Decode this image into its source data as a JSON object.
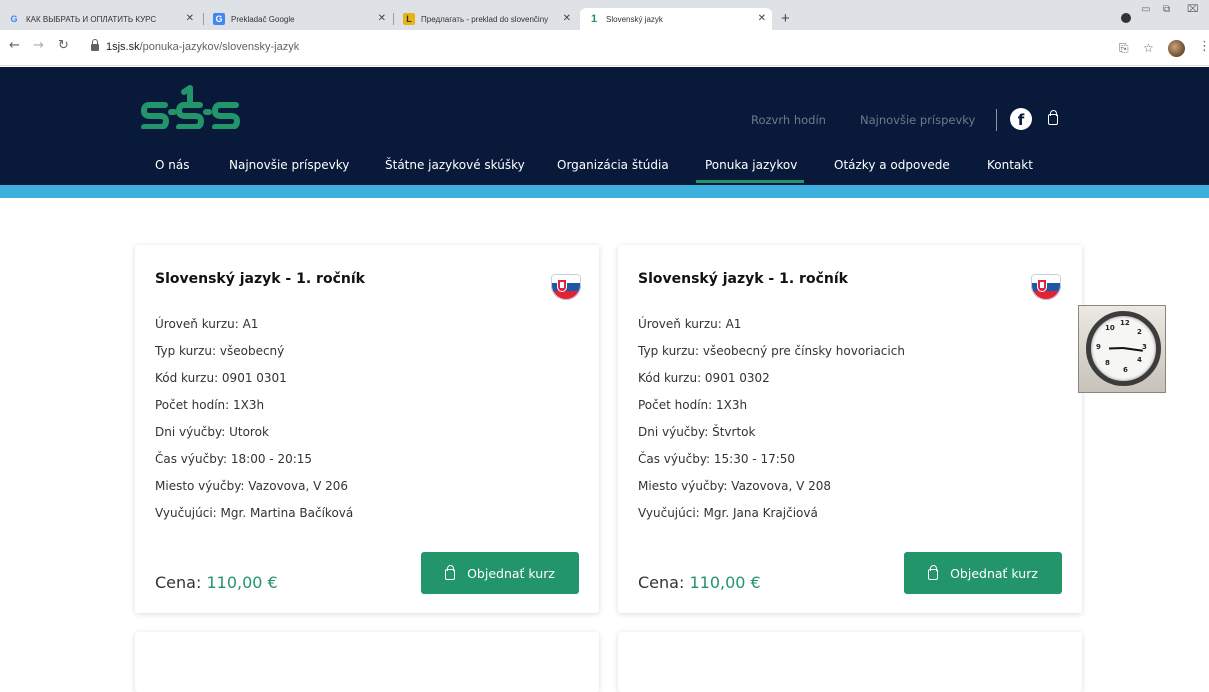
{
  "browser": {
    "tabs": [
      {
        "favicon": "G",
        "title": "КАК ВЫБРАТЬ И ОПЛАТИТЬ КУРС"
      },
      {
        "favicon": "translate-icon",
        "title": "Prekladač Google"
      },
      {
        "favicon": "L",
        "title": "Предлагать - preklad do slovenčiny"
      },
      {
        "favicon": "1sjs-icon",
        "title": "Slovenský jazyk"
      }
    ],
    "url_domain": "1sjs.sk",
    "url_path": "/ponuka-jazykov/slovensky-jazyk"
  },
  "site": {
    "logo_text": "1sjs",
    "top_links": [
      "Rozvrh hodín",
      "Najnovšie príspevky"
    ],
    "nav": [
      "O nás",
      "Najnovšie príspevky",
      "Štátne jazykové skúšky",
      "Organizácia štúdia",
      "Ponuka jazykov",
      "Otázky a odpovede",
      "Kontakt"
    ],
    "active_nav": "Ponuka jazykov"
  },
  "courses": [
    {
      "title": "Slovenský jazyk - 1. ročník",
      "level": "Úroveň kurzu: A1",
      "type": "Typ kurzu: všeobecný",
      "code": "Kód kurzu: 0901 0301",
      "hours": "Počet hodín: 1X3h",
      "days": "Dni výučby: Utorok",
      "time": "Čas výučby: 18:00 - 20:15",
      "place": "Miesto výučby: Vazovova, V 206",
      "teacher": "Vyučujúci: Mgr. Martina Bačíková",
      "price_label": "Cena:",
      "price": "110,00 €",
      "button": "Objednať kurz"
    },
    {
      "title": "Slovenský jazyk - 1. ročník",
      "level": "Úroveň kurzu: A1",
      "type": "Typ kurzu: všeobecný pre čínsky hovoriacich",
      "code": "Kód kurzu: 0901 0302",
      "hours": "Počet hodín: 1X3h",
      "days": "Dni výučby: Štvrtok",
      "time": "Čas výučby: 15:30 - 17:50",
      "place": "Miesto výučby: Vazovova, V 208",
      "teacher": "Vyučujúci: Mgr. Jana Krajčiová",
      "price_label": "Cena:",
      "price": "110,00 €",
      "button": "Objednať kurz"
    }
  ],
  "colors": {
    "header_bg": "#08193a",
    "accent_green": "#23956a",
    "strip_blue": "#3eb0de"
  }
}
